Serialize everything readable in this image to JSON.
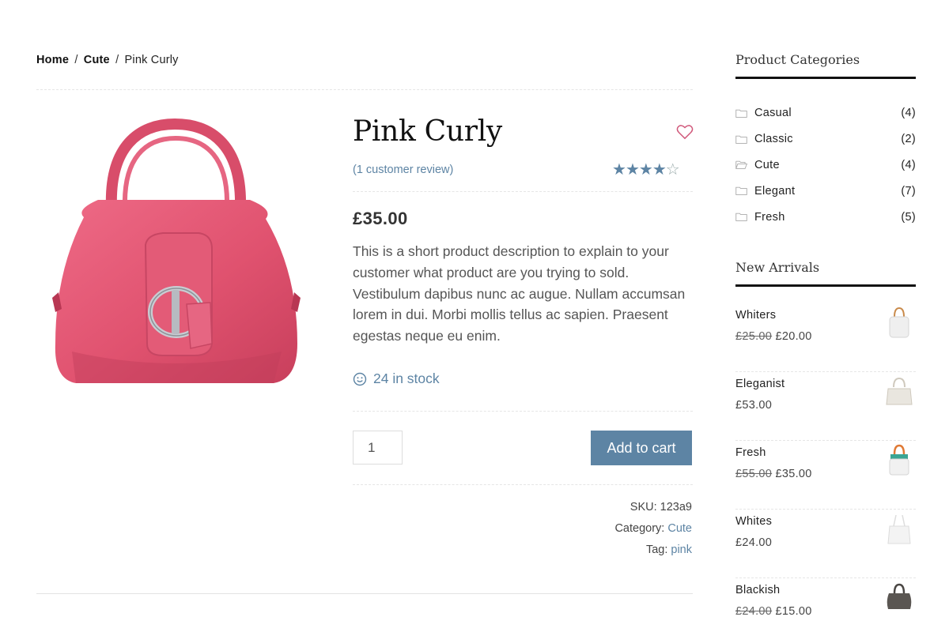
{
  "breadcrumb": {
    "home": "Home",
    "sep1": "/",
    "category": "Cute",
    "sep2": "/",
    "current": "Pink Curly"
  },
  "product": {
    "title": "Pink Curly",
    "review_link": "(1 customer review)",
    "rating": 4,
    "rating_max": 5,
    "price": "£35.00",
    "description": "This is a short product description to explain to your customer what product are you trying to sold. Vestibulum dapibus nunc ac augue. Nullam accumsan lorem in dui. Morbi mollis tellus ac sapien. Praesent egestas neque eu enim.",
    "stock": "24 in stock",
    "quantity": "1",
    "add_to_cart": "Add to cart",
    "sku_label": "SKU:",
    "sku": "123a9",
    "category_label": "Category:",
    "category": "Cute",
    "tag_label": "Tag:",
    "tag": "pink",
    "image_icon": "pink-handbag-image",
    "accent_color": "#5d84a4",
    "bag_color": "#e0526f"
  },
  "sidebar": {
    "categories_title": "Product Categories",
    "categories": [
      {
        "label": "Casual",
        "count": "(4)"
      },
      {
        "label": "Classic",
        "count": "(2)"
      },
      {
        "label": "Cute",
        "count": "(4)"
      },
      {
        "label": "Elegant",
        "count": "(7)"
      },
      {
        "label": "Fresh",
        "count": "(5)"
      }
    ],
    "arrivals_title": "New Arrivals",
    "arrivals": [
      {
        "name": "Whiters",
        "old_price": "£25.00",
        "price": "£20.00"
      },
      {
        "name": "Eleganist",
        "old_price": "",
        "price": "£53.00"
      },
      {
        "name": "Fresh",
        "old_price": "£55.00",
        "price": "£35.00"
      },
      {
        "name": "Whites",
        "old_price": "",
        "price": "£24.00"
      },
      {
        "name": "Blackish",
        "old_price": "£24.00",
        "price": "£15.00"
      }
    ]
  }
}
